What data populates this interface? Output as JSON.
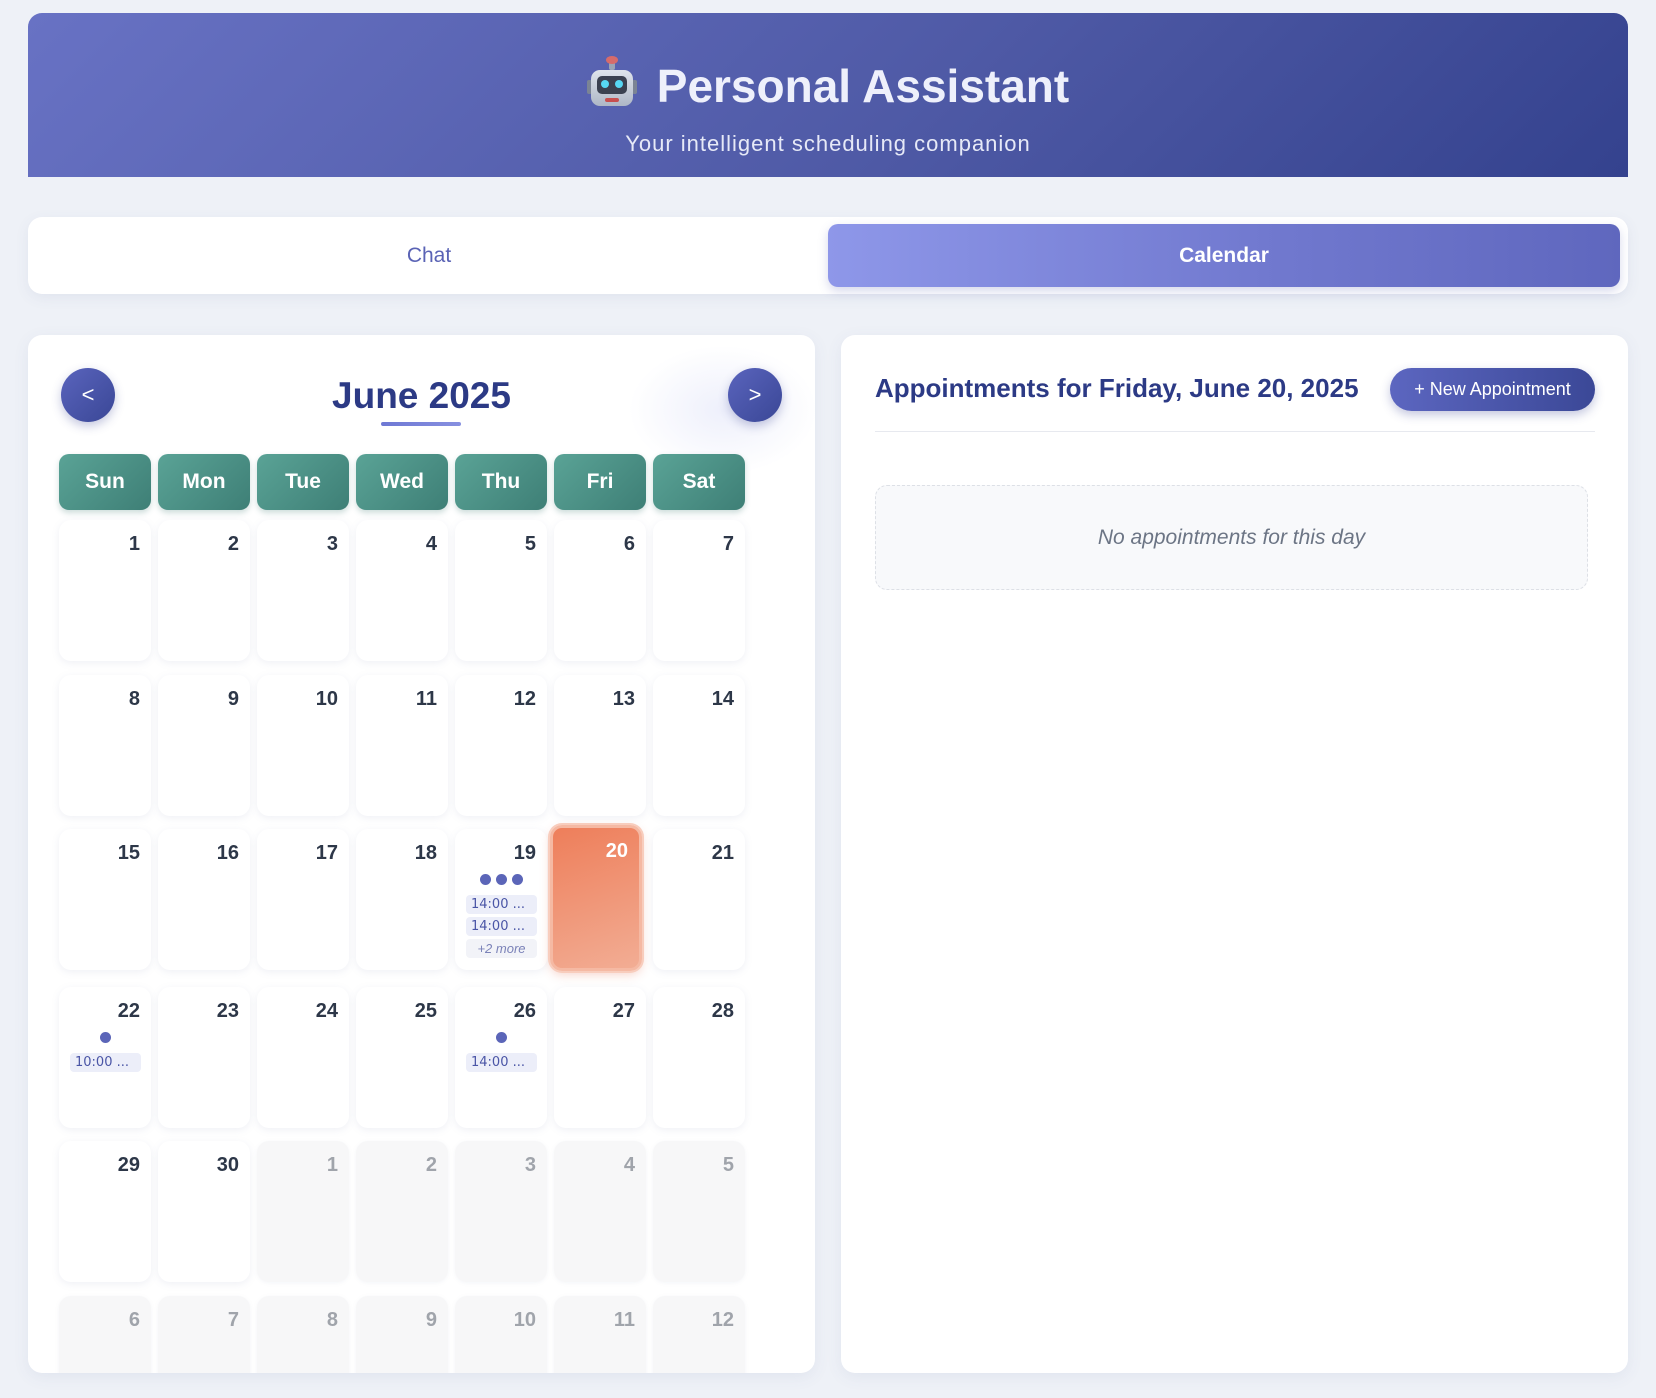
{
  "header": {
    "title": "Personal Assistant",
    "subtitle": "Your intelligent scheduling companion",
    "icon": "robot-icon"
  },
  "tabs": [
    {
      "label": "Chat",
      "active": false
    },
    {
      "label": "Calendar",
      "active": true
    }
  ],
  "calendar": {
    "month_label": "June 2025",
    "prev_label": "<",
    "next_label": ">",
    "weekdays": [
      "Sun",
      "Mon",
      "Tue",
      "Wed",
      "Thu",
      "Fri",
      "Sat"
    ],
    "selected_day": 20,
    "weeks": [
      [
        {
          "n": "1"
        },
        {
          "n": "2"
        },
        {
          "n": "3"
        },
        {
          "n": "4"
        },
        {
          "n": "5"
        },
        {
          "n": "6"
        },
        {
          "n": "7"
        }
      ],
      [
        {
          "n": "8"
        },
        {
          "n": "9"
        },
        {
          "n": "10"
        },
        {
          "n": "11"
        },
        {
          "n": "12"
        },
        {
          "n": "13"
        },
        {
          "n": "14"
        }
      ],
      [
        {
          "n": "15"
        },
        {
          "n": "16"
        },
        {
          "n": "17"
        },
        {
          "n": "18"
        },
        {
          "n": "19",
          "dots": 3,
          "chips": [
            "14:00 ...",
            "14:00 ..."
          ],
          "more": "+2 more"
        },
        {
          "n": "20",
          "selected": true
        },
        {
          "n": "21"
        }
      ],
      [
        {
          "n": "22",
          "dots": 1,
          "chips": [
            "10:00 ..."
          ]
        },
        {
          "n": "23"
        },
        {
          "n": "24"
        },
        {
          "n": "25"
        },
        {
          "n": "26",
          "dots": 1,
          "chips": [
            "14:00 ..."
          ]
        },
        {
          "n": "27"
        },
        {
          "n": "28"
        }
      ],
      [
        {
          "n": "29"
        },
        {
          "n": "30"
        },
        {
          "n": "1",
          "other": true
        },
        {
          "n": "2",
          "other": true
        },
        {
          "n": "3",
          "other": true
        },
        {
          "n": "4",
          "other": true
        },
        {
          "n": "5",
          "other": true
        }
      ],
      [
        {
          "n": "6",
          "other": true
        },
        {
          "n": "7",
          "other": true
        },
        {
          "n": "8",
          "other": true
        },
        {
          "n": "9",
          "other": true
        },
        {
          "n": "10",
          "other": true
        },
        {
          "n": "11",
          "other": true
        },
        {
          "n": "12",
          "other": true
        }
      ]
    ]
  },
  "appointments": {
    "title": "Appointments for Friday, June 20, 2025",
    "new_button": "+ New Appointment",
    "empty_text": "No appointments for this day"
  },
  "colors": {
    "header_start": "#6872c4",
    "header_end": "#34428e",
    "weekday_bg": "#4a8f84",
    "selected_day": "#ee7e5a",
    "accent": "#2c3a85"
  }
}
